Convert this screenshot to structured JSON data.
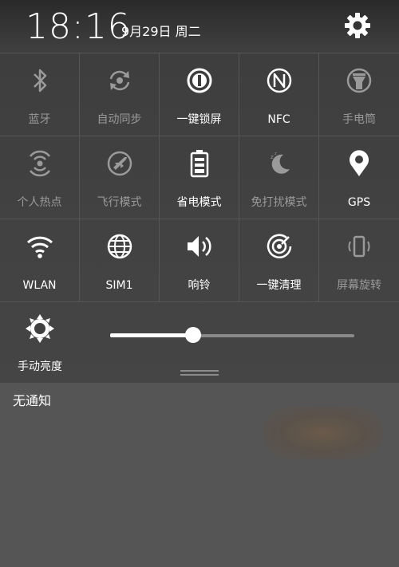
{
  "header": {
    "time": "18:16",
    "date": "9月29日 周二",
    "settings_icon": "gear-icon"
  },
  "tiles": [
    {
      "label": "蓝牙",
      "icon": "bluetooth-icon",
      "state": "off"
    },
    {
      "label": "自动同步",
      "icon": "sync-icon",
      "state": "off"
    },
    {
      "label": "一键锁屏",
      "icon": "lock-screen-icon",
      "state": "on"
    },
    {
      "label": "NFC",
      "icon": "nfc-icon",
      "state": "on"
    },
    {
      "label": "手电筒",
      "icon": "flashlight-icon",
      "state": "off"
    },
    {
      "label": "个人热点",
      "icon": "hotspot-icon",
      "state": "off"
    },
    {
      "label": "飞行模式",
      "icon": "airplane-icon",
      "state": "off"
    },
    {
      "label": "省电模式",
      "icon": "battery-icon",
      "state": "on"
    },
    {
      "label": "免打扰模式",
      "icon": "moon-icon",
      "state": "off"
    },
    {
      "label": "GPS",
      "icon": "location-icon",
      "state": "on"
    },
    {
      "label": "WLAN",
      "icon": "wifi-icon",
      "state": "on"
    },
    {
      "label": "SIM1",
      "icon": "globe-icon",
      "state": "on"
    },
    {
      "label": "响铃",
      "icon": "speaker-icon",
      "state": "on"
    },
    {
      "label": "一键清理",
      "icon": "clean-icon",
      "state": "on"
    },
    {
      "label": "屏幕旋转",
      "icon": "rotate-icon",
      "state": "off"
    }
  ],
  "brightness": {
    "label": "手动亮度",
    "icon": "brightness-icon",
    "level": 0.34
  },
  "notifications": {
    "empty_text": "无通知"
  },
  "colors": {
    "on": "#ffffff",
    "off": "#9a9a9a"
  }
}
